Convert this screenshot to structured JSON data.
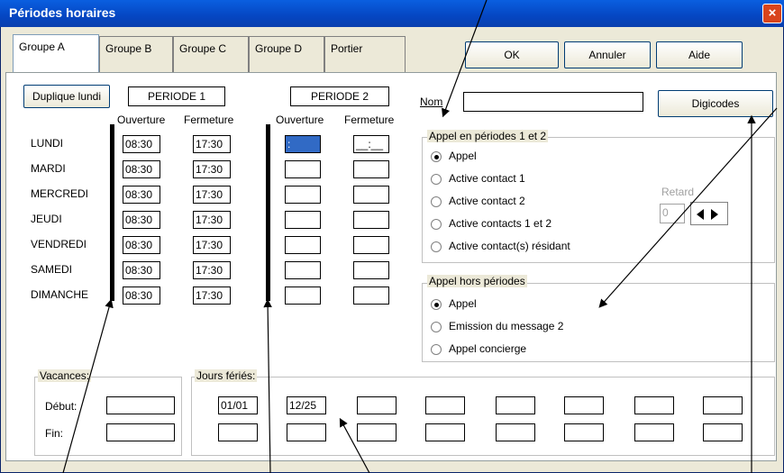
{
  "window": {
    "title": "Périodes horaires",
    "close_label": "×"
  },
  "tabs": [
    "Groupe A",
    "Groupe B",
    "Groupe C",
    "Groupe D",
    "Portier"
  ],
  "buttons": {
    "ok": "OK",
    "cancel": "Annuler",
    "help": "Aide",
    "duplicate": "Duplique lundi",
    "digicodes": "Digicodes"
  },
  "periods": {
    "p1": "PERIODE 1",
    "p2": "PERIODE 2",
    "open": "Ouverture",
    "close": "Fermeture"
  },
  "days": [
    "LUNDI",
    "MARDI",
    "MERCREDI",
    "JEUDI",
    "VENDREDI",
    "SAMEDI",
    "DIMANCHE"
  ],
  "p1_open": [
    "08:30",
    "08:30",
    "08:30",
    "08:30",
    "08:30",
    "08:30",
    "08:30"
  ],
  "p1_close": [
    "17:30",
    "17:30",
    "17:30",
    "17:30",
    "17:30",
    "17:30",
    "17:30"
  ],
  "p2_first_open": " :",
  "p2_first_close": "__:__",
  "name_label": "Nom",
  "name_value": "",
  "appel_periods": {
    "legend": "Appel en périodes 1 et 2",
    "options": [
      "Appel",
      "Active contact 1",
      "Active contact 2",
      "Active contacts 1 et 2",
      "Active contact(s) résidant"
    ],
    "selected": 0
  },
  "retard": {
    "label": "Retard",
    "value": "0"
  },
  "appel_hors": {
    "legend": "Appel hors périodes",
    "options": [
      "Appel",
      "Emission du message 2",
      "Appel concierge"
    ],
    "selected": 0
  },
  "vacances": {
    "legend": "Vacances:",
    "debut": "Début:",
    "fin": "Fin:"
  },
  "feries": {
    "legend": "Jours fériés:",
    "values": [
      "01/01",
      "12/25"
    ]
  }
}
